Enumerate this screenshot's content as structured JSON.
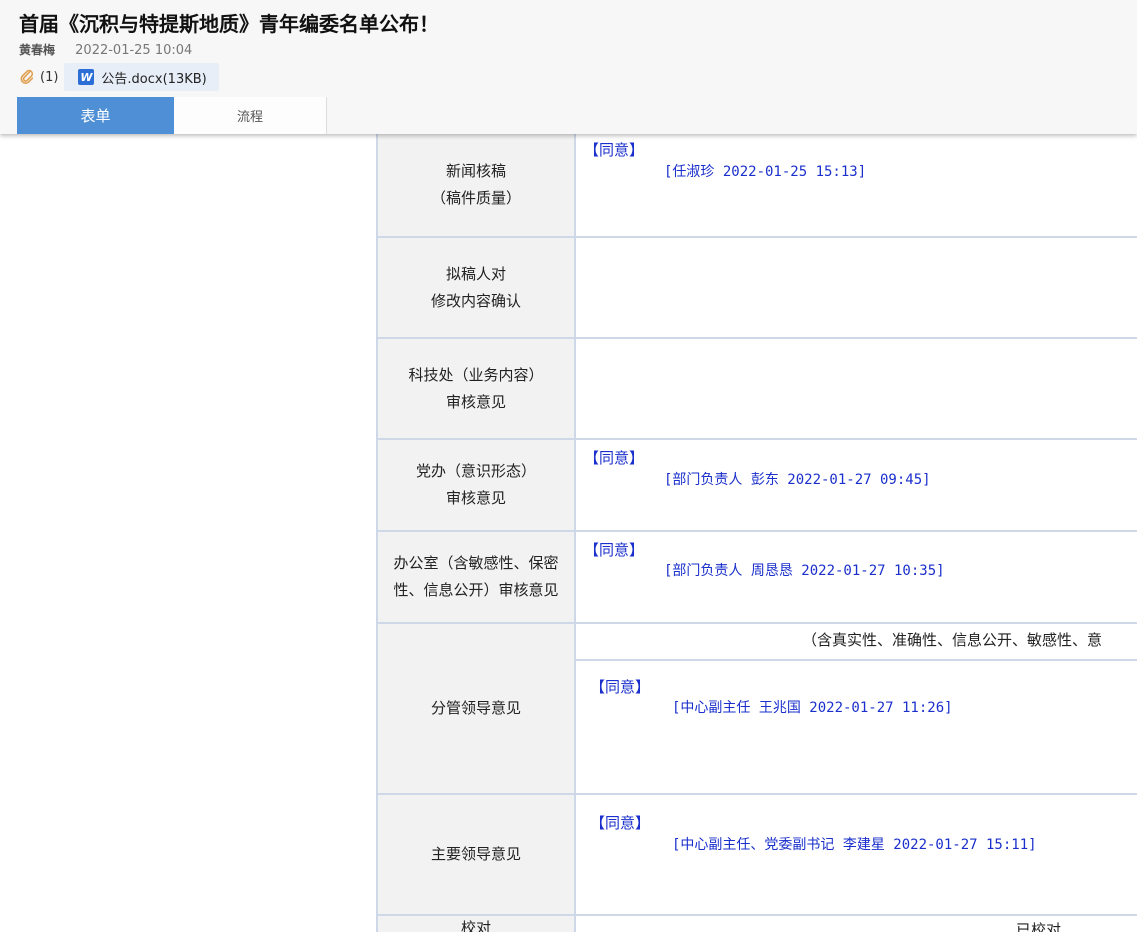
{
  "header": {
    "title": "首届《沉积与特提斯地质》青年编委名单公布！",
    "author": "黄春梅",
    "date": "2022-01-25 10:04",
    "attachment_count": "(1)",
    "attachment_name": "公告.docx(13KB)",
    "attachment_icon_letter": "W"
  },
  "tabs": [
    {
      "label": "表单",
      "active": true
    },
    {
      "label": "流程",
      "active": false
    }
  ],
  "rows": [
    {
      "label": "新闻核稿\n（稿件质量）",
      "agree": "【同意】",
      "sign": "[任淑珍 2022-01-25 15:13]"
    },
    {
      "label": "拟稿人对\n修改内容确认",
      "agree": "",
      "sign": ""
    },
    {
      "label": "科技处（业务内容）\n审核意见",
      "agree": "",
      "sign": ""
    },
    {
      "label": "党办（意识形态）\n审核意见",
      "agree": "【同意】",
      "sign": "[部门负责人 彭东 2022-01-27 09:45]"
    },
    {
      "label": "办公室（含敏感性、保密\n性、信息公开）审核意见",
      "agree": "【同意】",
      "sign": "[部门负责人 周恳恳 2022-01-27 10:35]"
    },
    {
      "label": "分管领导意见",
      "subheader": "（含真实性、准确性、信息公开、敏感性、意",
      "agree": "【同意】",
      "sign": "[中心副主任 王兆国 2022-01-27 11:26]"
    },
    {
      "label": "主要领导意见",
      "agree": "【同意】",
      "sign": "[中心副主任、党委副书记 李建星 2022-01-27 15:11]"
    },
    {
      "label": "校对",
      "value": "已校对"
    }
  ]
}
